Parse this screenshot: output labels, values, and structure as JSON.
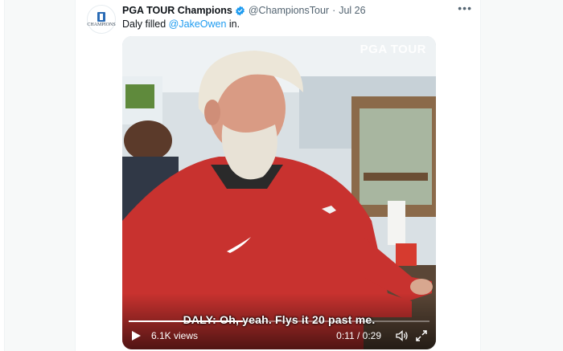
{
  "account": {
    "avatar_text": "CHAMPIONS",
    "display_name": "PGA TOUR Champions",
    "handle": "@ChampionsTour",
    "separator": "·",
    "date": "Jul 26"
  },
  "tweet": {
    "text_before": "Daly filled ",
    "mention": "@JakeOwen",
    "text_after": " in."
  },
  "video": {
    "watermark": "PGA TOUR",
    "subtitle": "DALY: Oh, yeah. Flys it 20 past me.",
    "views": "6.1K views",
    "time": "0:11 / 0:29",
    "progress_fraction": 0.379
  },
  "colors": {
    "accent": "#1d9bf0",
    "verified": "#1d9bf0",
    "shirt": "#c8322f"
  },
  "icons": {
    "more": "more-icon",
    "play": "play-icon",
    "volume": "volume-icon",
    "fullscreen": "fullscreen-icon"
  }
}
